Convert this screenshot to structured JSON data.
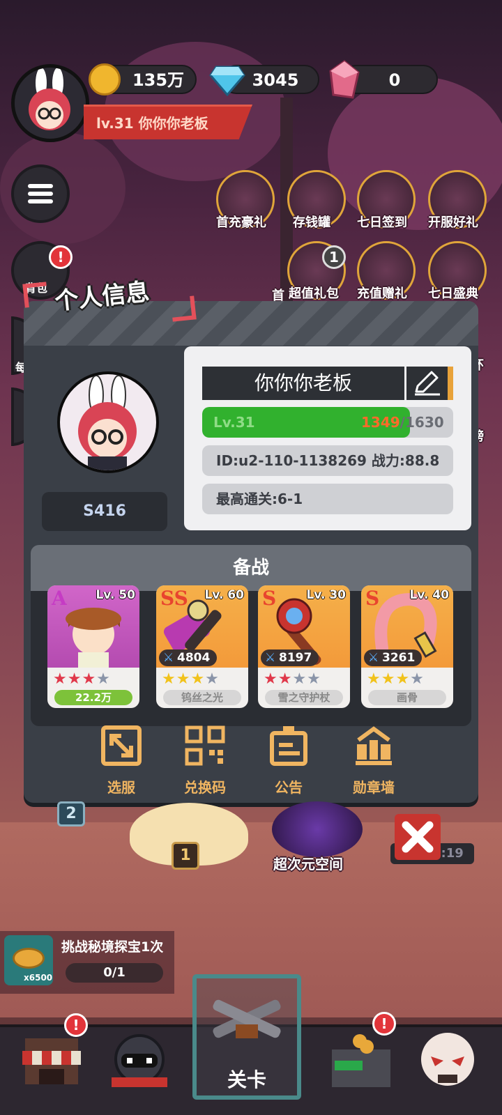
{
  "hud": {
    "coins": "135万",
    "diamonds": "3045",
    "crystals": "0",
    "player_banner": "lv.31  你你你老板"
  },
  "side_buttons": {
    "bag_label": "背包",
    "bag_badge": "!",
    "daily_label": "每"
  },
  "events": [
    {
      "label": "首充豪礼"
    },
    {
      "label": "存钱罐"
    },
    {
      "label": "七日签到"
    },
    {
      "label": "开服好礼"
    },
    {
      "label": "超值礼包",
      "badge": "1"
    },
    {
      "label": "充值赠礼"
    },
    {
      "label": "七日盛典"
    }
  ],
  "events_partial": {
    "left_cut": "首",
    "right_cut_1": "环",
    "right_cut_2": "榜"
  },
  "profile": {
    "title": "个人信息",
    "name": "你你你老板",
    "level": "Lv.31",
    "exp_current": "1349",
    "exp_sep": "/",
    "exp_max": "1630",
    "exp_fraction": 0.828,
    "id_power": "ID:u2-110-1138269 战力:88.8万",
    "best_stage": "最高通关:6-1",
    "server": "S416"
  },
  "prep": {
    "title": "备战",
    "cards": [
      {
        "rank": "A",
        "level": "Lv. 50",
        "stars_red": 3,
        "stars_gray": 1,
        "tag": "22.2万",
        "rank_color": "#c53bc4"
      },
      {
        "rank": "SS",
        "level": "Lv. 60",
        "power": "4804",
        "stars_gold": 3,
        "stars_gray": 1,
        "tag": "钨丝之光",
        "rank_color": "#e8442e"
      },
      {
        "rank": "S",
        "level": "Lv. 30",
        "power": "8197",
        "stars_red": 2,
        "stars_gray": 2,
        "tag": "雪之守护杖",
        "rank_color": "#e8442e"
      },
      {
        "rank": "S",
        "level": "Lv. 40",
        "power": "3261",
        "stars_gold": 3,
        "stars_gray": 1,
        "tag": "画骨",
        "rank_color": "#e8442e"
      }
    ]
  },
  "footer_buttons": [
    {
      "label": "选服",
      "icon": "server-switch-icon"
    },
    {
      "label": "兑换码",
      "icon": "qr-code-icon"
    },
    {
      "label": "公告",
      "icon": "announcement-icon"
    },
    {
      "label": "勋章墙",
      "icon": "medal-wall-icon"
    }
  ],
  "scene": {
    "stage_2": "2",
    "stage_1": "1",
    "portal_label": "超次元空间",
    "timer": "00:13:19"
  },
  "task": {
    "title": "挑战秘境探宝1次",
    "progress": "0/1",
    "reward_count": "x6500"
  },
  "bottom_nav": {
    "shop_badge": "!",
    "stage_label": "关卡",
    "chest_badge": "!"
  }
}
